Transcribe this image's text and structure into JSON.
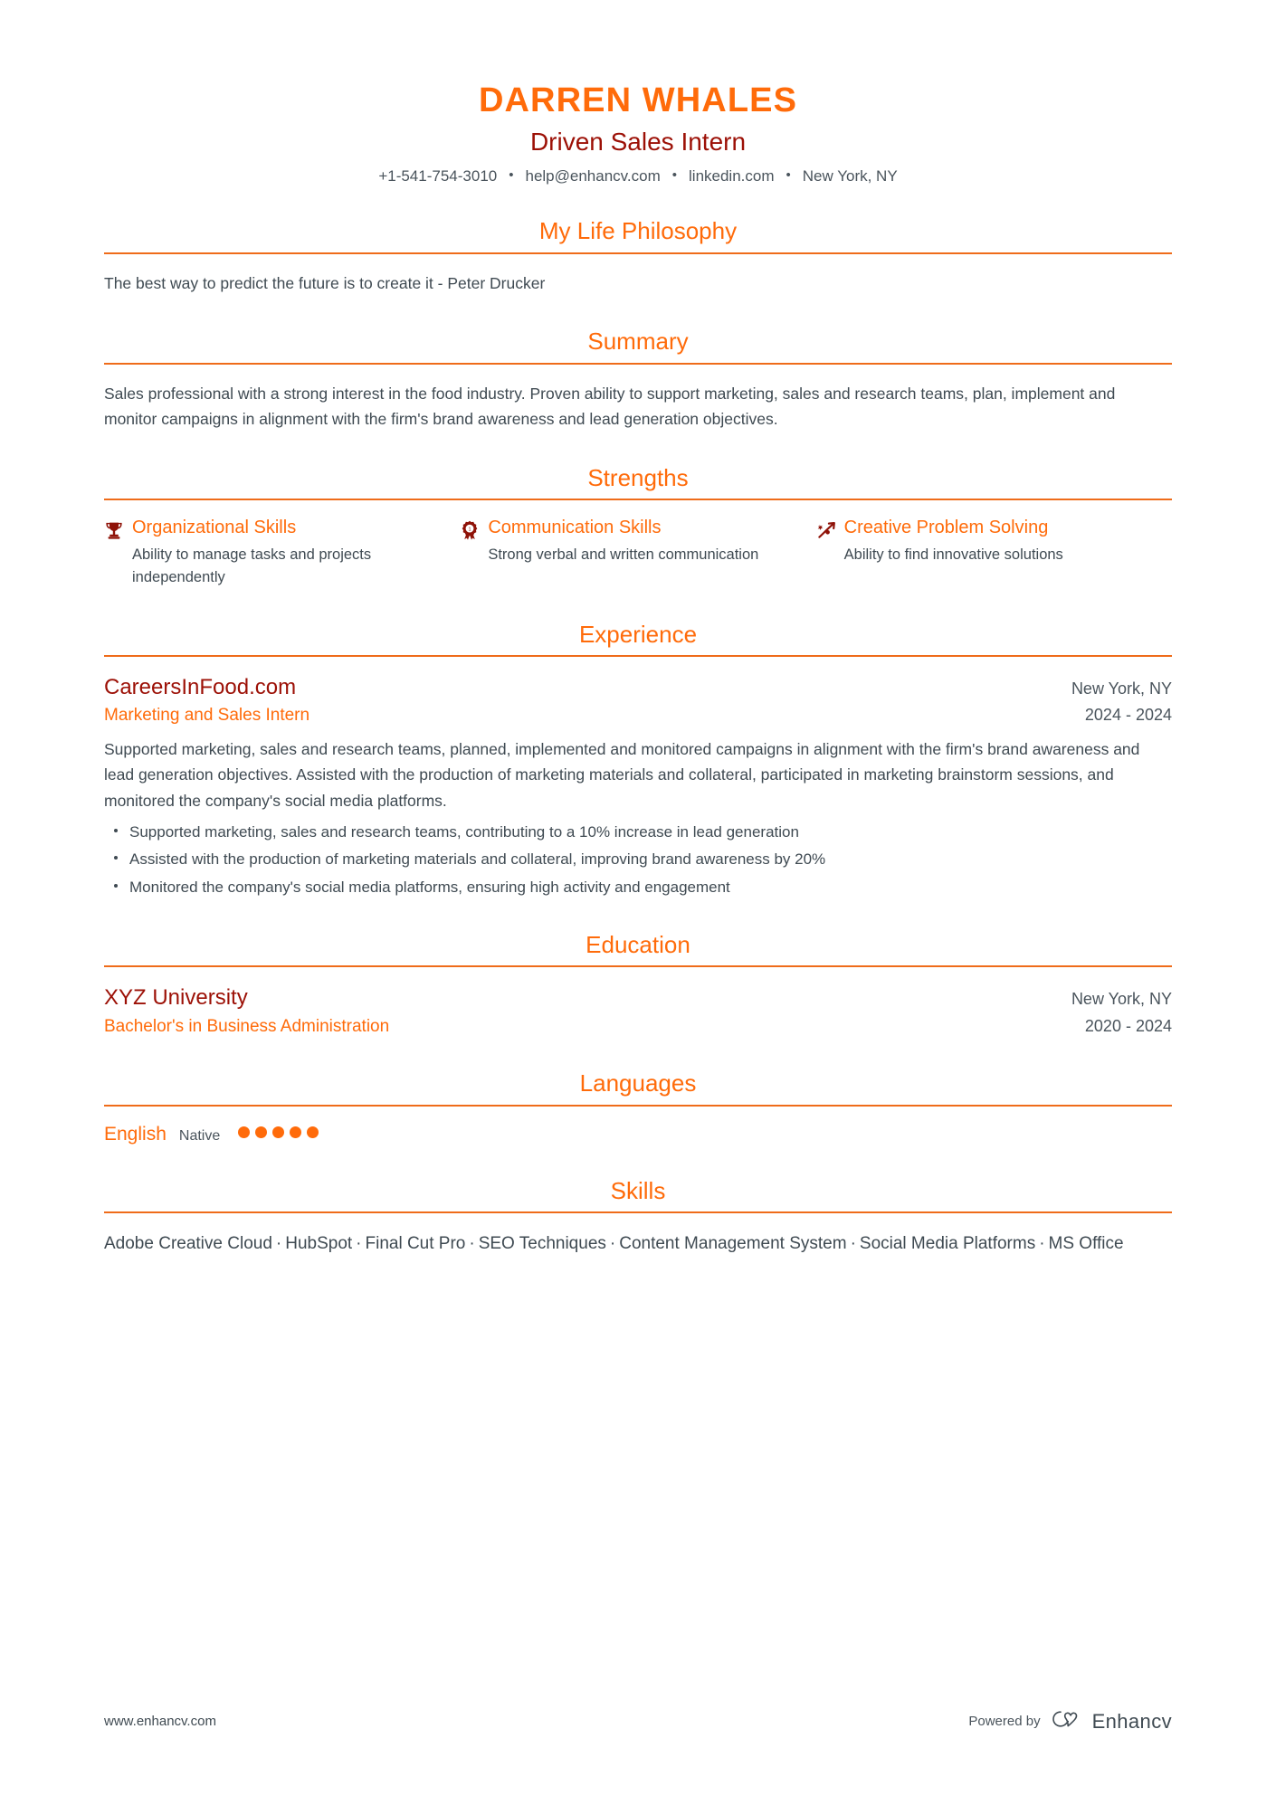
{
  "header": {
    "name": "DARREN WHALES",
    "title": "Driven Sales Intern",
    "contacts": [
      {
        "label": "+1-541-754-3010",
        "name": "phone"
      },
      {
        "label": "help@enhancv.com",
        "name": "email"
      },
      {
        "label": "linkedin.com",
        "name": "linkedin"
      },
      {
        "label": "New York, NY",
        "name": "location"
      }
    ],
    "separator": "•",
    "name_color": "#ff6b0a",
    "title_color": "#9c1006"
  },
  "philosophy": {
    "title": "My Life Philosophy",
    "quote": "The best way to predict the future is to create it - Peter Drucker"
  },
  "summary": {
    "title": "Summary",
    "text": "Sales professional with a strong interest in the food industry. Proven ability to support marketing, sales and research teams, plan, implement and monitor campaigns in alignment with the firm's brand awareness and lead generation objectives."
  },
  "strengths": {
    "title": "Strengths",
    "items": [
      {
        "icon": "trophy-icon",
        "name": "Organizational Skills",
        "description": "Ability to manage tasks and projects independently"
      },
      {
        "icon": "award-medal-icon",
        "name": "Communication Skills",
        "description": "Strong verbal and written communication"
      },
      {
        "icon": "rocket-arrow-icon",
        "name": "Creative Problem Solving",
        "description": "Ability to find innovative solutions"
      }
    ]
  },
  "experience": {
    "title": "Experience",
    "entries": [
      {
        "organization": "CareersInFood.com",
        "role": "Marketing and Sales Intern",
        "location": "New York, NY",
        "dates": "2024 - 2024",
        "description": "Supported marketing, sales and research teams, planned, implemented and monitored campaigns in alignment with the firm's brand awareness and lead generation objectives. Assisted with the production of marketing materials and collateral, participated in marketing brainstorm sessions, and monitored the company's social media platforms.",
        "bullets": [
          "Supported marketing, sales and research teams, contributing to a 10% increase in lead generation",
          "Assisted with the production of marketing materials and collateral, improving brand awareness by 20%",
          "Monitored the company's social media platforms, ensuring high activity and engagement"
        ]
      }
    ]
  },
  "education": {
    "title": "Education",
    "entries": [
      {
        "organization": "XYZ University",
        "degree": "Bachelor's in Business Administration",
        "location": "New York, NY",
        "dates": "2020 - 2024"
      }
    ]
  },
  "languages": {
    "title": "Languages",
    "items": [
      {
        "name": "English",
        "level": "Native",
        "filled": 5,
        "total": 5
      }
    ]
  },
  "skills": {
    "title": "Skills",
    "separator": "·",
    "items": [
      "Adobe Creative Cloud",
      "HubSpot",
      "Final Cut Pro",
      "SEO Techniques",
      "Content Management System",
      "Social Media Platforms",
      "MS Office"
    ]
  },
  "footer": {
    "url": "www.enhancv.com",
    "powered_by": "Powered by",
    "brand": "Enhancv"
  },
  "theme": {
    "accent": "#ff6b0a",
    "rule": "#ef6c1a",
    "dark_red": "#9c1006",
    "text": "#3f4a52"
  }
}
